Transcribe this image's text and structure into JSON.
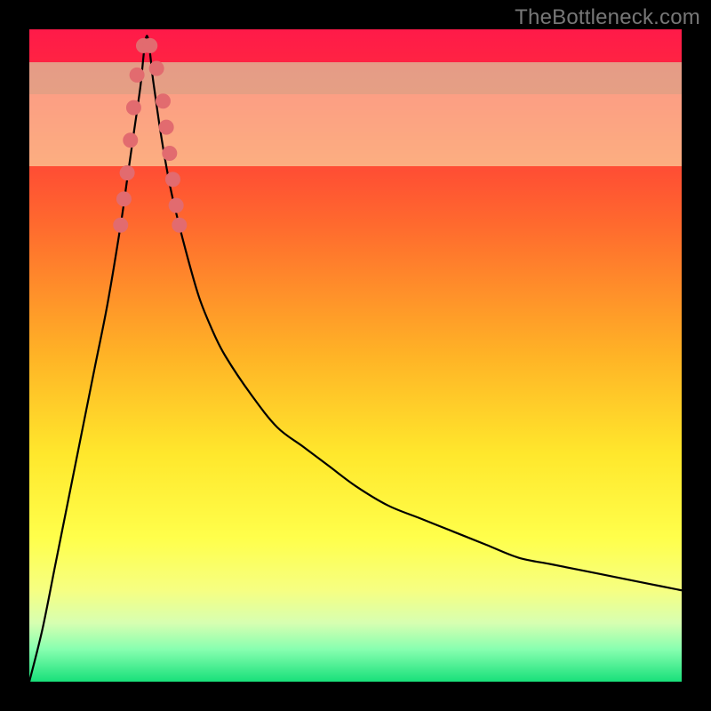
{
  "watermark": "TheBottleneck.com",
  "chart_data": {
    "type": "line",
    "title": "",
    "xlabel": "",
    "ylabel": "",
    "xlim": [
      0,
      100
    ],
    "ylim": [
      0,
      100
    ],
    "x_optimum": 18,
    "gradient_stops": [
      {
        "pct": 0,
        "color": "#ff1a49"
      },
      {
        "pct": 12,
        "color": "#ff2f3a"
      },
      {
        "pct": 30,
        "color": "#ff6a2e"
      },
      {
        "pct": 50,
        "color": "#ffb326"
      },
      {
        "pct": 65,
        "color": "#ffe72c"
      },
      {
        "pct": 78,
        "color": "#ffff4b"
      },
      {
        "pct": 86,
        "color": "#f6ff82"
      },
      {
        "pct": 91,
        "color": "#d7ffb1"
      },
      {
        "pct": 95,
        "color": "#88ffb0"
      },
      {
        "pct": 100,
        "color": "#18e07a"
      }
    ],
    "zone_bands": [
      {
        "y_from": 79,
        "y_to": 90,
        "color": "#faffbf",
        "opacity": 0.55
      },
      {
        "y_from": 90,
        "y_to": 95,
        "color": "#cfffc0",
        "opacity": 0.55
      }
    ],
    "series": [
      {
        "name": "bottleneck-curve",
        "stroke": "#000000",
        "stroke_width": 2.2,
        "x": [
          0,
          2,
          4,
          6,
          8,
          10,
          12,
          14,
          15,
          16,
          17,
          18,
          19,
          20,
          21,
          22,
          24,
          26,
          28,
          30,
          34,
          38,
          42,
          46,
          50,
          55,
          60,
          65,
          70,
          75,
          80,
          85,
          90,
          95,
          100
        ],
        "y": [
          0,
          8,
          18,
          28,
          38,
          48,
          58,
          70,
          77,
          84,
          91,
          99,
          92,
          85,
          79,
          74,
          66,
          59,
          54,
          50,
          44,
          39,
          36,
          33,
          30,
          27,
          25,
          23,
          21,
          19,
          18,
          17,
          16,
          15,
          14
        ]
      }
    ],
    "markers": {
      "name": "sample-points",
      "shape": "circle",
      "fill": "#e26b6f",
      "stroke": "#e26b6f",
      "radius": 8,
      "points": [
        {
          "x": 14.0,
          "y": 70
        },
        {
          "x": 14.5,
          "y": 74
        },
        {
          "x": 15.0,
          "y": 78
        },
        {
          "x": 15.5,
          "y": 83
        },
        {
          "x": 16.0,
          "y": 88
        },
        {
          "x": 16.5,
          "y": 93
        },
        {
          "x": 17.5,
          "y": 97.5
        },
        {
          "x": 18.5,
          "y": 97.5
        },
        {
          "x": 19.5,
          "y": 94
        },
        {
          "x": 20.5,
          "y": 89
        },
        {
          "x": 21.0,
          "y": 85
        },
        {
          "x": 21.5,
          "y": 81
        },
        {
          "x": 22.0,
          "y": 77
        },
        {
          "x": 22.5,
          "y": 73
        },
        {
          "x": 23.0,
          "y": 70
        }
      ]
    }
  }
}
